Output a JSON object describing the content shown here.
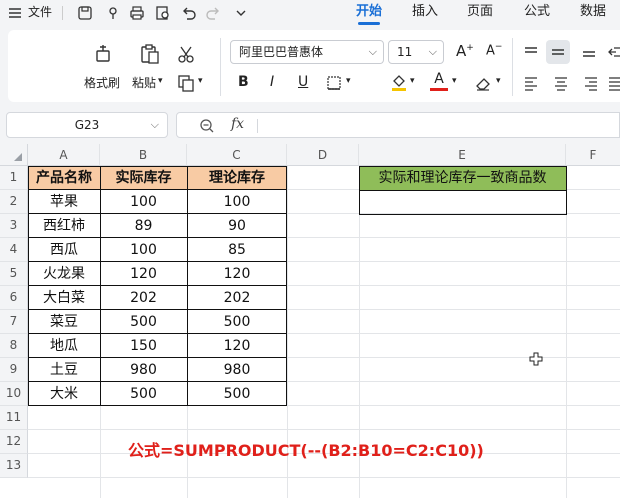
{
  "menu": {
    "file_label": "文件",
    "tabs": [
      "开始",
      "插入",
      "页面",
      "公式",
      "数据"
    ],
    "active_tab": "开始"
  },
  "ribbon": {
    "format_painter_label": "格式刷",
    "paste_label": "粘贴",
    "font_name": "阿里巴巴普惠体",
    "font_size": "11",
    "bold_label": "B",
    "italic_label": "I",
    "underline_label": "U",
    "font_color_letter": "A",
    "accent_colors": {
      "fill": "#f5c400",
      "font": "#e0201a"
    }
  },
  "formula_bar": {
    "name_box": "G23",
    "fx_label": "fx",
    "content": ""
  },
  "sheet": {
    "columns": [
      "A",
      "B",
      "C",
      "D",
      "E",
      "F"
    ],
    "rows": [
      "1",
      "2",
      "3",
      "4",
      "5",
      "6",
      "7",
      "8",
      "9",
      "10",
      "11",
      "12",
      "13"
    ],
    "table": {
      "headers": [
        "产品名称",
        "实际库存",
        "理论库存"
      ],
      "rows": [
        [
          "苹果",
          "100",
          "100"
        ],
        [
          "西红柿",
          "89",
          "90"
        ],
        [
          "西瓜",
          "100",
          "85"
        ],
        [
          "火龙果",
          "120",
          "120"
        ],
        [
          "大白菜",
          "202",
          "202"
        ],
        [
          "菜豆",
          "500",
          "500"
        ],
        [
          "地瓜",
          "150",
          "120"
        ],
        [
          "土豆",
          "980",
          "980"
        ],
        [
          "大米",
          "500",
          "500"
        ]
      ]
    },
    "result_header": "实际和理论库存一致商品数",
    "result_value": "",
    "formula_note": "公式=SUMPRODUCT(--(B2:B10=C2:C10))"
  }
}
